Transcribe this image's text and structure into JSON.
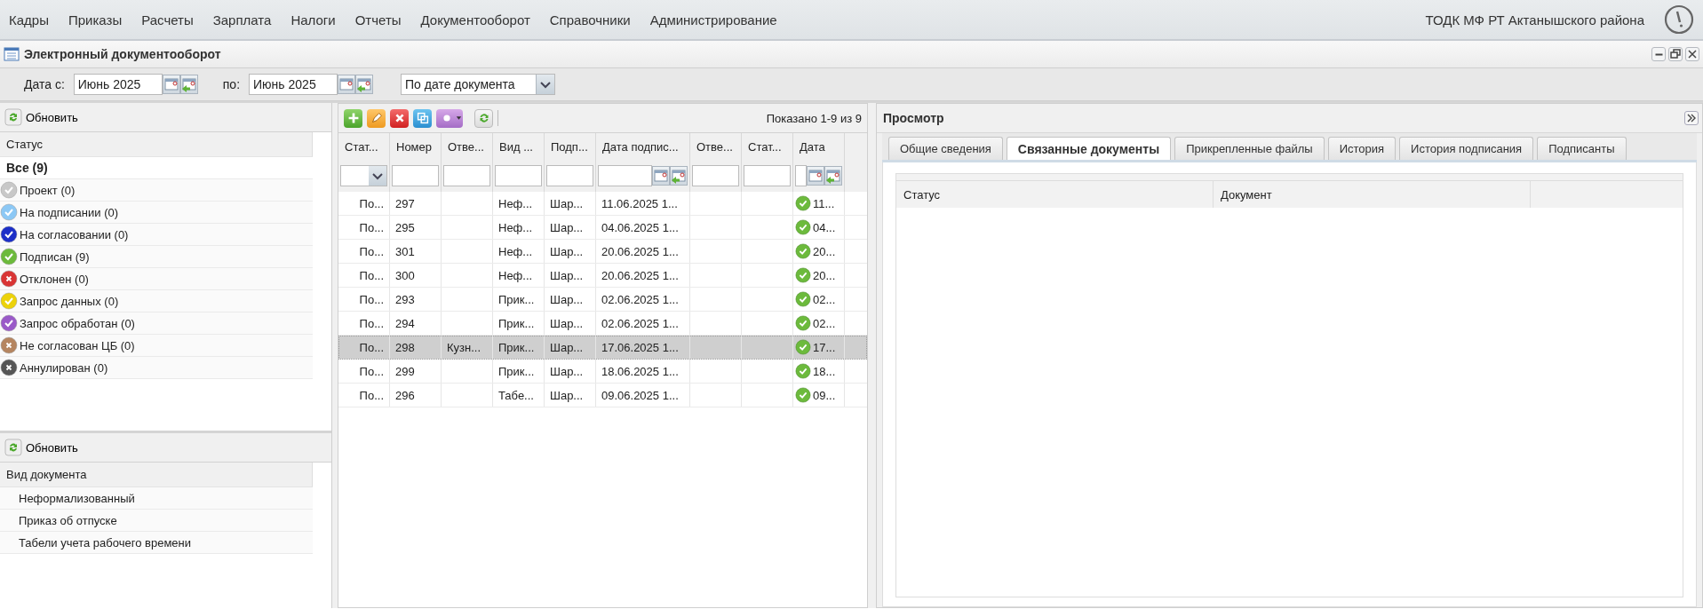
{
  "menu": [
    "Кадры",
    "Приказы",
    "Расчеты",
    "Зарплата",
    "Налоги",
    "Отчеты",
    "Документооборот",
    "Справочники",
    "Администрирование"
  ],
  "org": "ТОДК МФ РТ Актанышского района",
  "window": {
    "title": "Электронный документооборот"
  },
  "filter": {
    "from_label": "Дата с:",
    "from_value": "Июнь 2025",
    "to_label": "по:",
    "to_value": "Июнь 2025",
    "mode": "По дате документа"
  },
  "status_panel": {
    "refresh": "Обновить",
    "header": "Статус",
    "items": [
      {
        "label": "Все (9)",
        "kind": "all",
        "selected": true
      },
      {
        "label": "Проект (0)",
        "kind": "check",
        "color": "#c8c8c8",
        "selected": false
      },
      {
        "label": "На подписании (0)",
        "kind": "check",
        "color": "#8cc8f5",
        "selected": false
      },
      {
        "label": "На согласовании (0)",
        "kind": "check",
        "color": "#1c2fc8",
        "selected": false
      },
      {
        "label": "Подписан (9)",
        "kind": "check",
        "color": "#6cba3c",
        "selected": false
      },
      {
        "label": "Отклонен (0)",
        "kind": "cross",
        "color": "#d93535",
        "selected": false
      },
      {
        "label": "Запрос данных (0)",
        "kind": "check",
        "color": "#ecd20a",
        "selected": false
      },
      {
        "label": "Запрос обработан (0)",
        "kind": "check",
        "color": "#9a5ac8",
        "selected": false
      },
      {
        "label": "Не согласован ЦБ (0)",
        "kind": "cross",
        "color": "#b58560",
        "selected": false
      },
      {
        "label": "Аннулирован (0)",
        "kind": "cross",
        "color": "#555555",
        "selected": false
      }
    ]
  },
  "type_panel": {
    "refresh": "Обновить",
    "header": "Вид документа",
    "items": [
      {
        "label": "Неформализованный",
        "selected": false
      },
      {
        "label": "Приказ об отпуске",
        "selected": false
      },
      {
        "label": "Табели учета рабочего времени",
        "selected": false
      }
    ]
  },
  "grid": {
    "paging": "Показано 1-9 из 9",
    "columns": [
      {
        "label": "Стат...",
        "kind": "combo"
      },
      {
        "label": "Номер",
        "kind": "text"
      },
      {
        "label": "Отве...",
        "kind": "text"
      },
      {
        "label": "Вид ...",
        "kind": "text"
      },
      {
        "label": "Подп...",
        "kind": "text"
      },
      {
        "label": "Дата подпис...",
        "kind": "date"
      },
      {
        "label": "Отве...",
        "kind": "text"
      },
      {
        "label": "Стат...",
        "kind": "text"
      },
      {
        "label": "Дата",
        "kind": "signed_date"
      }
    ],
    "rows": [
      {
        "cells": [
          "По...",
          "297",
          "",
          "Неф...",
          "Шар...",
          "11.06.2025 1...",
          "",
          "",
          "11..."
        ],
        "selected": false
      },
      {
        "cells": [
          "По...",
          "295",
          "",
          "Неф...",
          "Шар...",
          "04.06.2025 1...",
          "",
          "",
          "04..."
        ],
        "selected": false
      },
      {
        "cells": [
          "По...",
          "301",
          "",
          "Неф...",
          "Шар...",
          "20.06.2025 1...",
          "",
          "",
          "20..."
        ],
        "selected": false
      },
      {
        "cells": [
          "По...",
          "300",
          "",
          "Неф...",
          "Шар...",
          "20.06.2025 1...",
          "",
          "",
          "20..."
        ],
        "selected": false
      },
      {
        "cells": [
          "По...",
          "293",
          "",
          "Прик...",
          "Шар...",
          "02.06.2025 1...",
          "",
          "",
          "02..."
        ],
        "selected": false
      },
      {
        "cells": [
          "По...",
          "294",
          "",
          "Прик...",
          "Шар...",
          "02.06.2025 1...",
          "",
          "",
          "02..."
        ],
        "selected": false
      },
      {
        "cells": [
          "По...",
          "298",
          "Кузн...",
          "Прик...",
          "Шар...",
          "17.06.2025 1...",
          "",
          "",
          "17..."
        ],
        "selected": true
      },
      {
        "cells": [
          "По...",
          "299",
          "",
          "Прик...",
          "Шар...",
          "18.06.2025 1...",
          "",
          "",
          "18..."
        ],
        "selected": false
      },
      {
        "cells": [
          "По...",
          "296",
          "",
          "Табе...",
          "Шар...",
          "09.06.2025 1...",
          "",
          "",
          "09..."
        ],
        "selected": false
      }
    ]
  },
  "preview": {
    "title": "Просмотр",
    "tabs": [
      {
        "label": "Общие сведения",
        "selected": false
      },
      {
        "label": "Связанные документы",
        "selected": true
      },
      {
        "label": "Прикрепленные файлы",
        "selected": false
      },
      {
        "label": "История",
        "selected": false
      },
      {
        "label": "История подписания",
        "selected": false
      },
      {
        "label": "Подписанты",
        "selected": false
      }
    ],
    "columns": [
      "Статус",
      "Документ"
    ]
  }
}
